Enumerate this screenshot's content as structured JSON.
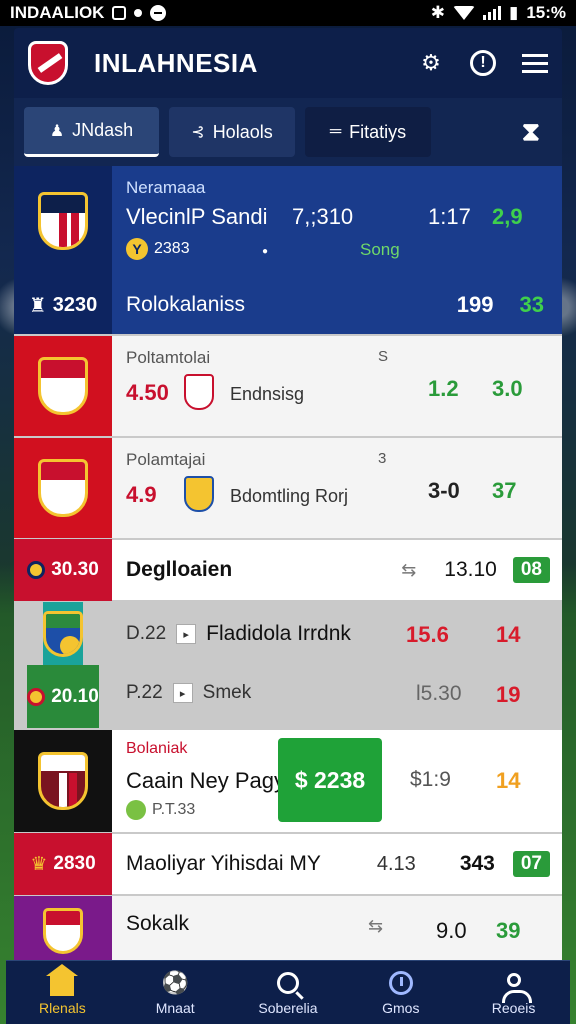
{
  "status": {
    "carrier": "INDAALIOK",
    "battery": "15:%"
  },
  "header": {
    "title": "INLAHNESIA"
  },
  "tabs": [
    {
      "label": "JNdash"
    },
    {
      "label": "Holaols"
    },
    {
      "label": "Fitatiys"
    }
  ],
  "featured": {
    "sub": "Neramaaa",
    "team": "VlecinlP Sandi",
    "score": "7,;310",
    "time": "1:17",
    "odd": "2,9",
    "badge_value": "2383",
    "song": "Song",
    "code": "3230",
    "name": "Rolokalaniss",
    "n1": "199",
    "n2": "33"
  },
  "matches": [
    {
      "sub": "Poltamtolai",
      "s": "S",
      "odd": "4.50",
      "opponent": "Endnsisg",
      "v1": "1.2",
      "v2": "3.0"
    },
    {
      "sub": "Polamtajai",
      "s": "3",
      "odd": "4.9",
      "opponent": "Bdomtling Rorj",
      "v1": "3-0",
      "v2": "37"
    }
  ],
  "bar1": {
    "code": "30.30",
    "name": "Deglloaien",
    "n1": "13.10",
    "pill": "08"
  },
  "teal": {
    "code": "20.10",
    "l1_num": "D.22",
    "l1_text": "Fladidola Irrdnk",
    "r1": "15.6",
    "r2": "14",
    "l2_num": "P.22",
    "l2_text": "Smek",
    "r3": "l5.30",
    "r4": "19"
  },
  "promo": {
    "red": "Bolaniak",
    "title": "Caain Ney Pagy",
    "chip": "P.T.33",
    "button": "$ 2238",
    "o1": "$1:9",
    "o2": "14"
  },
  "bar2": {
    "code": "2830",
    "name": "Maoliyar Yihisdai MY",
    "n0": "4.13",
    "n1": "343",
    "pill": "07"
  },
  "last": {
    "title": "Sokalk",
    "v1": "9.0",
    "v2": "39"
  },
  "nav": [
    {
      "label": "Rlenals",
      "icon": "home-icon"
    },
    {
      "label": "Mnaat",
      "icon": "soccer-icon"
    },
    {
      "label": "Soberelia",
      "icon": "search-icon"
    },
    {
      "label": "Gmos",
      "icon": "clock-icon"
    },
    {
      "label": "Reoeis",
      "icon": "user-icon"
    }
  ]
}
